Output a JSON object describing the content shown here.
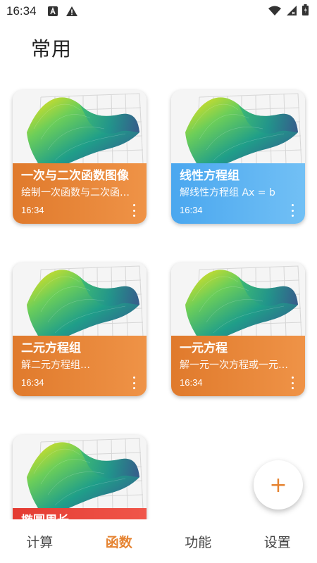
{
  "status_bar": {
    "time": "16:34",
    "icons": [
      "a-notification-icon",
      "warning-icon",
      "wifi-icon",
      "signal-icon",
      "battery-icon"
    ]
  },
  "section_title": "常用",
  "cards": [
    {
      "title": "一次与二次函数图像",
      "desc": "绘制一次函数与二次函数图像",
      "time": "16:34",
      "color": "#e07a2c"
    },
    {
      "title": "线性方程组",
      "desc": "解线性方程组 Ax = b",
      "time": "16:34",
      "color": "#4aa7ef"
    },
    {
      "title": "二元方程组",
      "desc": "解二元方程组…",
      "time": "16:34",
      "color": "#e07a2c"
    },
    {
      "title": "一元方程",
      "desc": "解一元一次方程或一元二次方程",
      "time": "16:34",
      "color": "#e07a2c"
    },
    {
      "title": "椭圆周长",
      "desc": "",
      "time": "",
      "color": "#e43b32"
    }
  ],
  "fab": {
    "label": "+"
  },
  "bottom_nav": {
    "items": [
      {
        "label": "计算"
      },
      {
        "label": "函数"
      },
      {
        "label": "功能"
      },
      {
        "label": "设置"
      }
    ],
    "active_index": 1,
    "active_color": "#e58331"
  }
}
